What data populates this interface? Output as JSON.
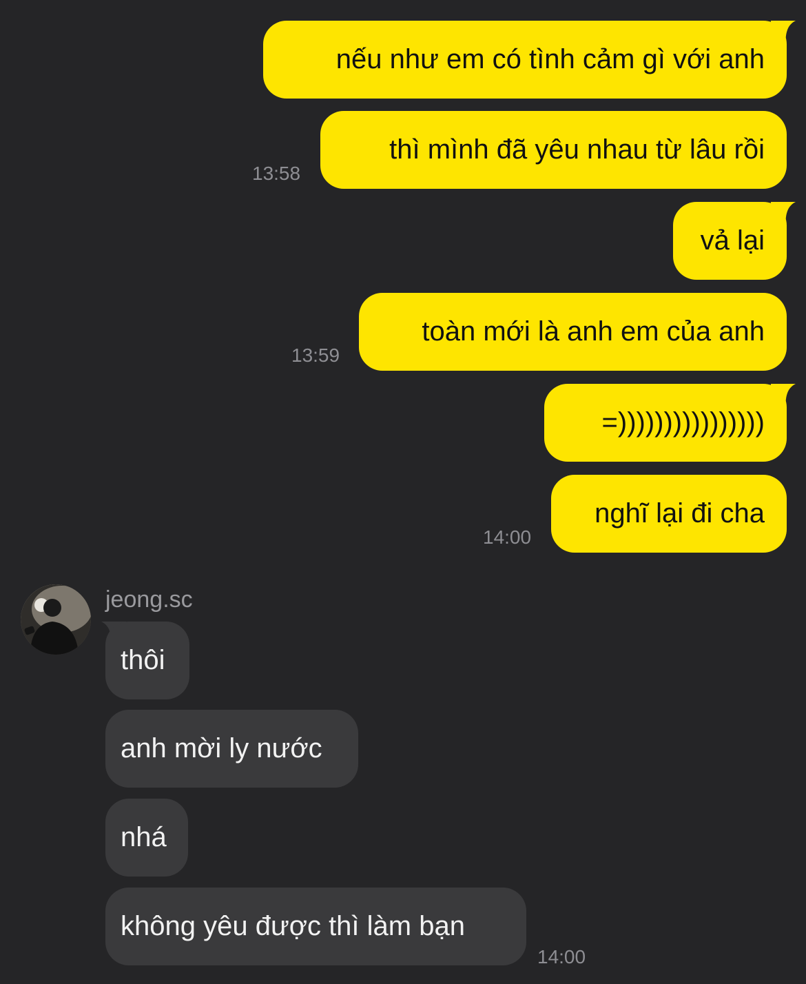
{
  "outgoing": [
    {
      "text": "nếu như em có tình cảm gì với anh"
    },
    {
      "text": "thì mình đã yêu nhau từ lâu rồi",
      "time": "13:58"
    },
    {
      "text": "vả lại"
    },
    {
      "text": "toàn mới là anh em của anh",
      "time": "13:59"
    },
    {
      "text": "=))))))))))))))))"
    },
    {
      "text": "nghĩ lại đi cha",
      "time": "14:00"
    }
  ],
  "incoming": {
    "sender": "jeong.sc",
    "messages": [
      {
        "text": "thôi"
      },
      {
        "text": "anh mời ly nước"
      },
      {
        "text": "nhá"
      },
      {
        "text": "không yêu được thì làm bạn",
        "time": "14:00"
      }
    ]
  },
  "colors": {
    "background": "#252527",
    "outgoing_bubble": "#FEE500",
    "incoming_bubble": "#3A3A3C",
    "timestamp": "#8E8E93"
  }
}
